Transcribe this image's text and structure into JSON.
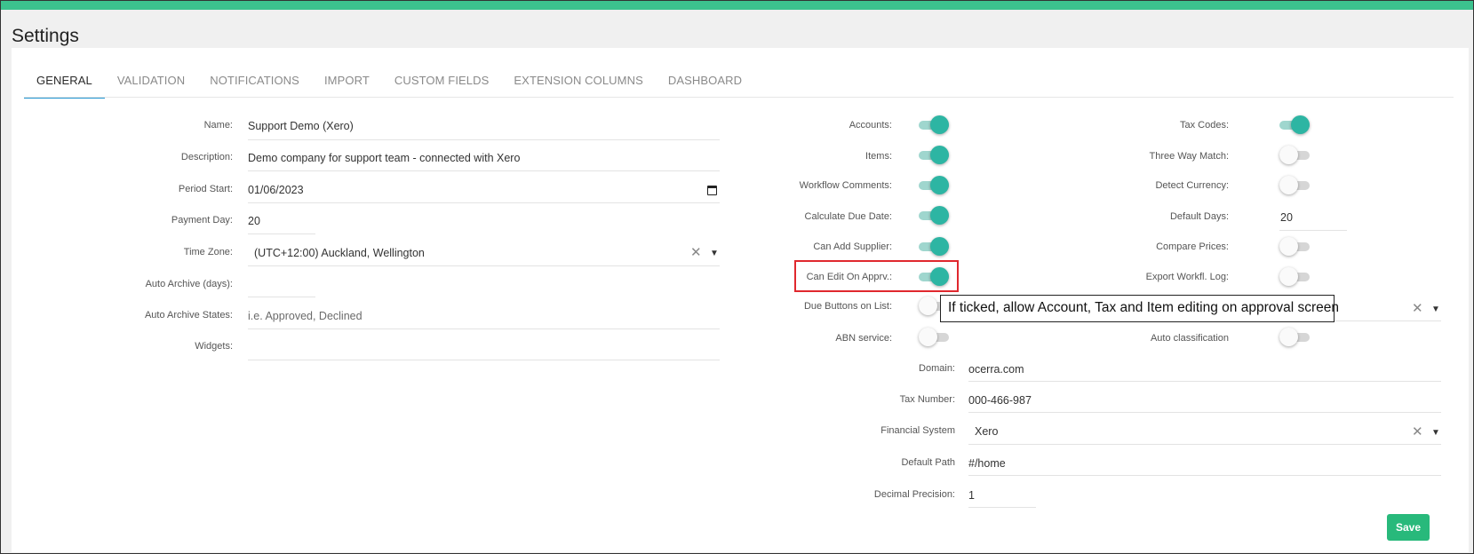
{
  "page": {
    "title": "Settings"
  },
  "tabs": [
    {
      "label": "GENERAL"
    },
    {
      "label": "VALIDATION"
    },
    {
      "label": "NOTIFICATIONS"
    },
    {
      "label": "IMPORT"
    },
    {
      "label": "CUSTOM FIELDS"
    },
    {
      "label": "EXTENSION COLUMNS"
    },
    {
      "label": "DASHBOARD"
    }
  ],
  "general": {
    "name": {
      "label": "Name:",
      "value": "Support Demo (Xero)"
    },
    "description": {
      "label": "Description:",
      "value": "Demo company for support team - connected with Xero"
    },
    "period_start": {
      "label": "Period Start:",
      "value": "01/06/2023"
    },
    "payment_day": {
      "label": "Payment Day:",
      "value": "20"
    },
    "time_zone": {
      "label": "Time Zone:",
      "value": "(UTC+12:00) Auckland, Wellington"
    },
    "auto_archive_days": {
      "label": "Auto Archive (days):",
      "value": ""
    },
    "auto_archive_states": {
      "label": "Auto Archive States:",
      "placeholder": "i.e. Approved, Declined"
    },
    "widgets": {
      "label": "Widgets:",
      "value": ""
    }
  },
  "toggles_mid": [
    {
      "label": "Accounts:",
      "on": true
    },
    {
      "label": "Items:",
      "on": true
    },
    {
      "label": "Workflow Comments:",
      "on": true
    },
    {
      "label": "Calculate Due Date:",
      "on": true
    },
    {
      "label": "Can Add Supplier:",
      "on": true
    },
    {
      "label": "Can Edit On Apprv.:",
      "on": true
    },
    {
      "label": "Due Buttons on List:",
      "on": false
    },
    {
      "label": "ABN service:",
      "on": false
    }
  ],
  "toggles_right": {
    "tax_codes": {
      "label": "Tax Codes:",
      "on": true
    },
    "three_way_match": {
      "label": "Three Way Match:",
      "on": false
    },
    "detect_currency": {
      "label": "Detect Currency:",
      "on": false
    },
    "default_days": {
      "label": "Default Days:",
      "value": "20"
    },
    "compare_prices": {
      "label": "Compare Prices:",
      "on": false
    },
    "export_workfl_log": {
      "label": "Export Workfl. Log:",
      "on": false
    },
    "auto_classification": {
      "label": "Auto classification",
      "on": false
    }
  },
  "lower": {
    "domain": {
      "label": "Domain:",
      "value": "ocerra.com"
    },
    "tax_number": {
      "label": "Tax Number:",
      "value": "000-466-987"
    },
    "financial_system": {
      "label": "Financial System",
      "value": "Xero"
    },
    "default_path": {
      "label": "Default Path",
      "value": "#/home"
    },
    "decimal_precision": {
      "label": "Decimal Precision:",
      "value": "1"
    }
  },
  "tooltip": {
    "text": "If ticked, allow Account, Tax and Item editing on approval screen"
  },
  "actions": {
    "save_label": "Save"
  },
  "colors": {
    "accent": "#3cc28e",
    "toggle_on": "#2db5a3",
    "tab_active": "#2196d3",
    "highlight": "#e0282e",
    "save": "#28b97b"
  }
}
